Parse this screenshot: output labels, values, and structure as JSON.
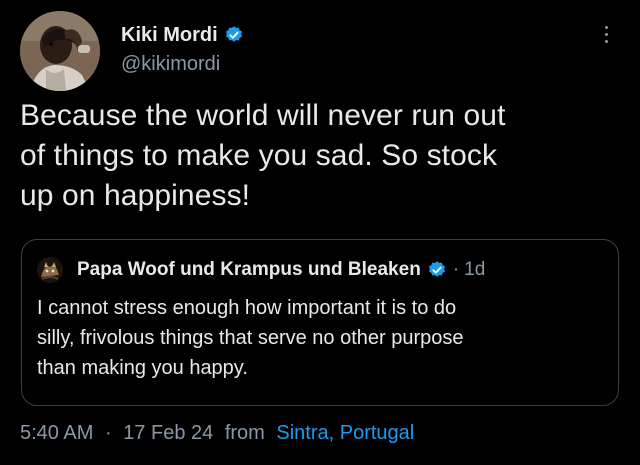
{
  "tweet": {
    "author": {
      "name": "Kiki Mordi",
      "handle": "@kikimordi",
      "verified_icon": "verified-badge-icon",
      "avatar_icon": "profile-photo"
    },
    "more_icon": "more-options-icon",
    "text": "Because the world will never run out\nof things to make you sad. So stock\nup on happiness!",
    "quote": {
      "author_name": "Papa Woof und Krampus und Bleaken",
      "verified_icon": "verified-badge-icon",
      "separator": "·",
      "time": "1d",
      "text": "I cannot stress enough how important it is to do\nsilly, frivolous things that serve no other purpose\nthan making you happy."
    },
    "meta": {
      "time": "5:40 AM",
      "separator": "·",
      "date": "17 Feb 24",
      "from": "from",
      "location": "Sintra, Portugal"
    }
  },
  "colors": {
    "background": "#000000",
    "text_primary": "#e7e9ea",
    "text_secondary": "#8b98a5",
    "accent": "#1d9bf0",
    "border": "#3b4046"
  }
}
